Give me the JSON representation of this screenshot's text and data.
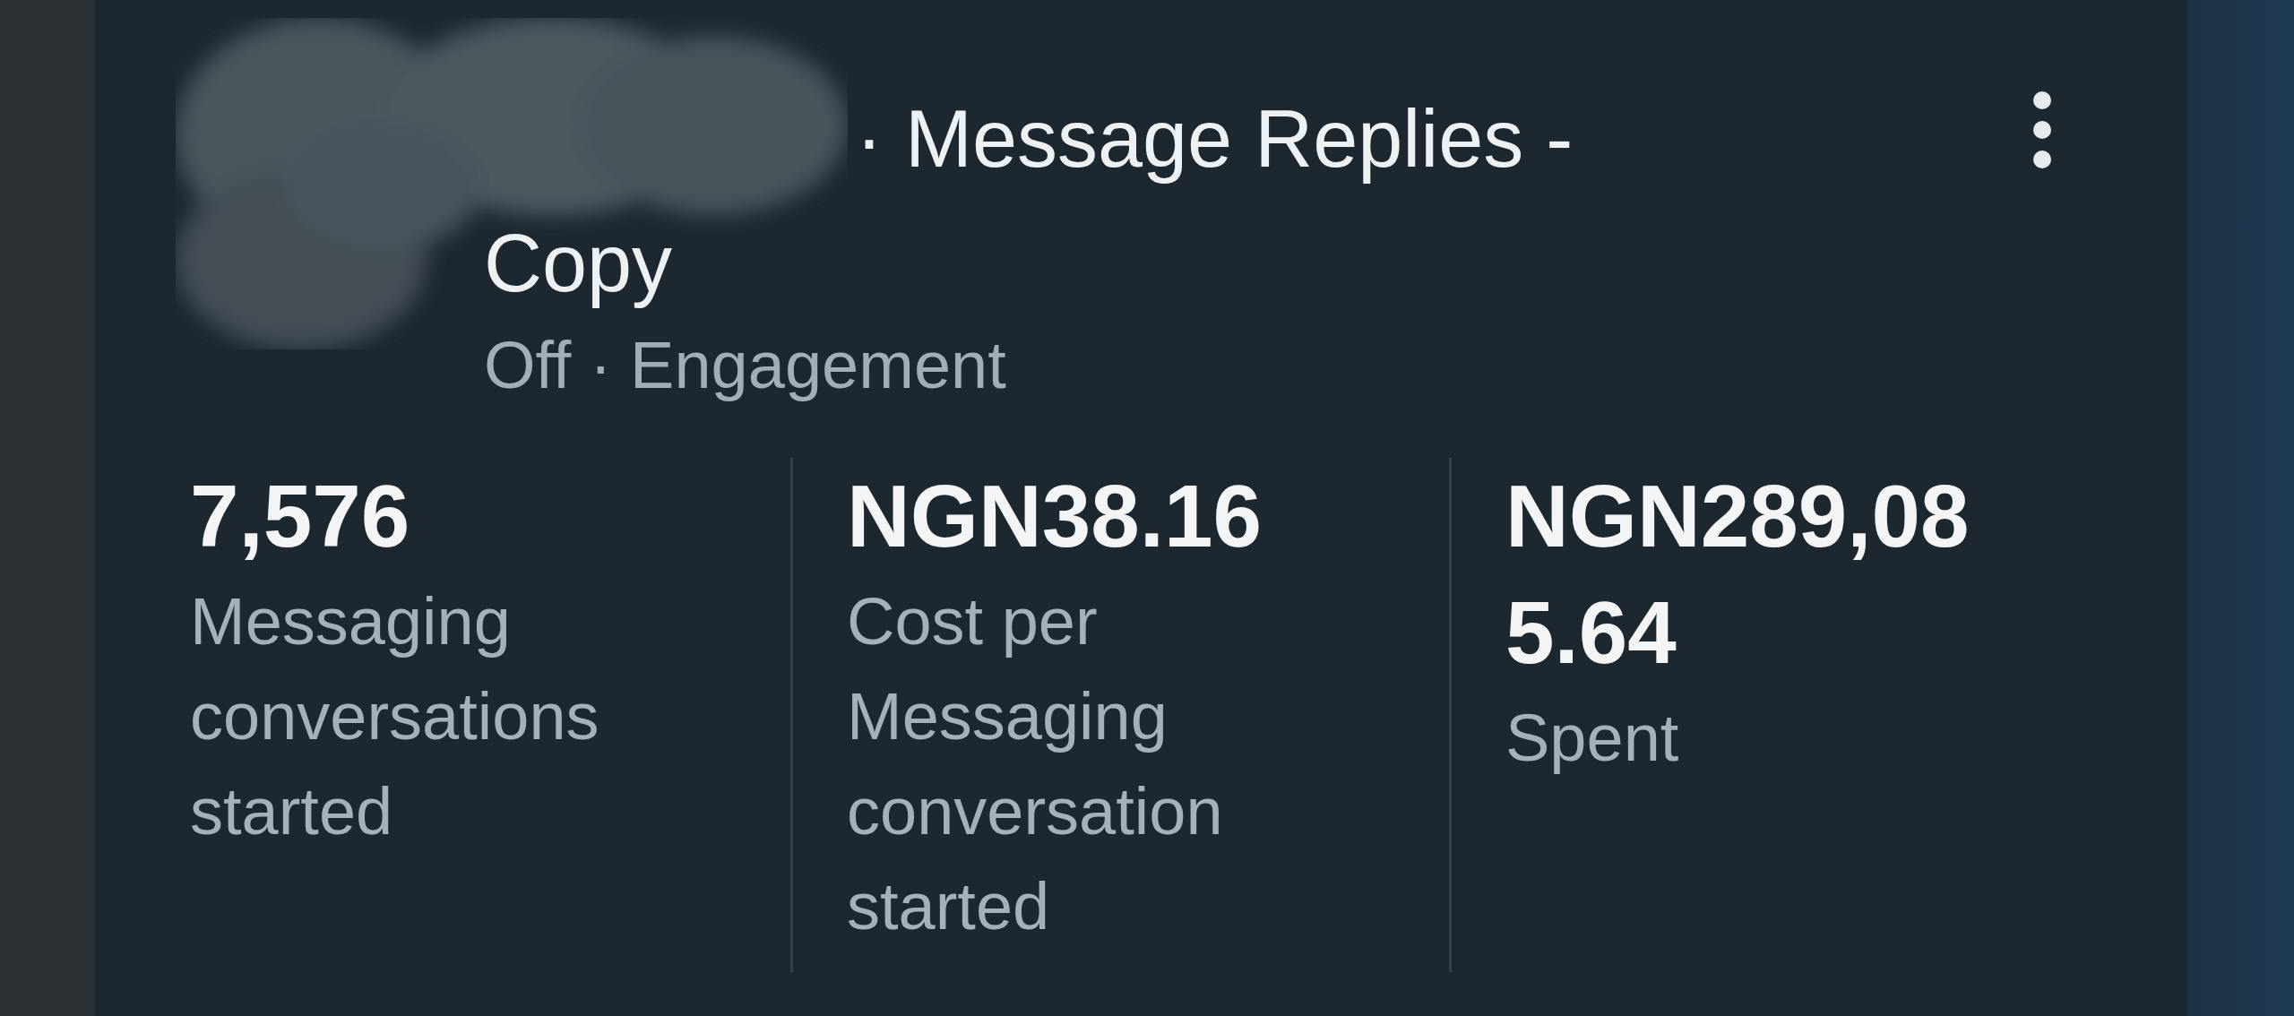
{
  "campaign": {
    "title": "· Message Replies - Copy",
    "subtitle": "Off · Engagement"
  },
  "metrics": [
    {
      "value": "7,576",
      "label": "Messaging conversations started"
    },
    {
      "value": "NGN38.16",
      "label": "Cost per Messaging conversation started"
    },
    {
      "value": "NGN289,085.64",
      "label": "Spent"
    }
  ]
}
